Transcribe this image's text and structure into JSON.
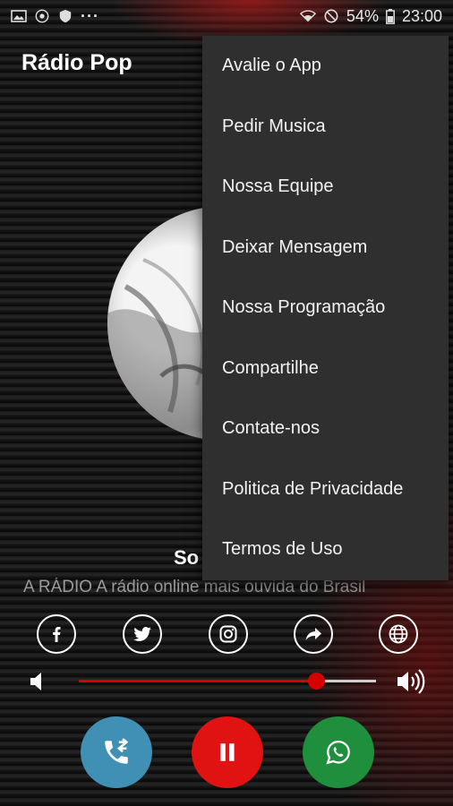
{
  "status_bar": {
    "battery": "54%",
    "time": "23:00",
    "more_indicator": "···"
  },
  "app_bar": {
    "title": "Rádio Pop"
  },
  "player": {
    "song_title": "So",
    "station_line": "A RÁDIO  A rádio online mais ouvida do Brasil"
  },
  "social": [
    {
      "icon": "facebook-icon"
    },
    {
      "icon": "twitter-icon"
    },
    {
      "icon": "instagram-icon"
    },
    {
      "icon": "share-icon"
    },
    {
      "icon": "globe-icon"
    }
  ],
  "volume": {
    "level": 0.8
  },
  "controls": {
    "call_icon": "call-forward-icon",
    "pause_icon": "pause-icon",
    "whatsapp_icon": "whatsapp-icon"
  },
  "menu": {
    "items": [
      {
        "label": "Avalie o App"
      },
      {
        "label": "Pedir Musica"
      },
      {
        "label": "Nossa Equipe"
      },
      {
        "label": "Deixar Mensagem"
      },
      {
        "label": "Nossa Programação"
      },
      {
        "label": "Compartilhe"
      },
      {
        "label": "Contate-nos"
      },
      {
        "label": "Politica de Privacidade"
      },
      {
        "label": "Termos de Uso"
      }
    ]
  },
  "colors": {
    "accent_red": "#d40000",
    "menu_bg": "#2f2f2f",
    "call_blue": "#3f90b4",
    "whatsapp_green": "#1f8f3e"
  }
}
